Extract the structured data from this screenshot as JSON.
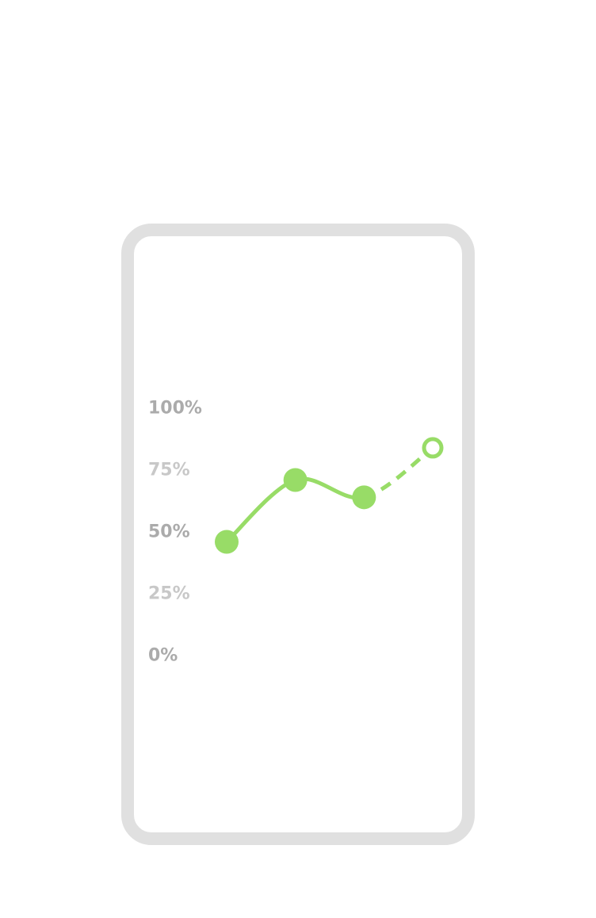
{
  "colors": {
    "frame": "#e0e0e0",
    "line": "#98dc67",
    "tick_strong": "#ababab",
    "tick_light": "#c8c8c8"
  },
  "chart_data": {
    "type": "line",
    "title": "",
    "xlabel": "",
    "ylabel": "",
    "ylim": [
      0,
      100
    ],
    "yticks": [
      {
        "value": 100,
        "label": "100%",
        "tone": "strong"
      },
      {
        "value": 75,
        "label": "75%",
        "tone": "light"
      },
      {
        "value": 50,
        "label": "50%",
        "tone": "strong"
      },
      {
        "value": 25,
        "label": "25%",
        "tone": "light"
      },
      {
        "value": 0,
        "label": "0%",
        "tone": "strong"
      }
    ],
    "x": [
      1,
      2,
      3,
      4
    ],
    "series": [
      {
        "values": [
          46,
          71,
          64,
          84
        ],
        "projected": [
          false,
          false,
          false,
          true
        ]
      }
    ],
    "grid": false,
    "legend": "none"
  }
}
